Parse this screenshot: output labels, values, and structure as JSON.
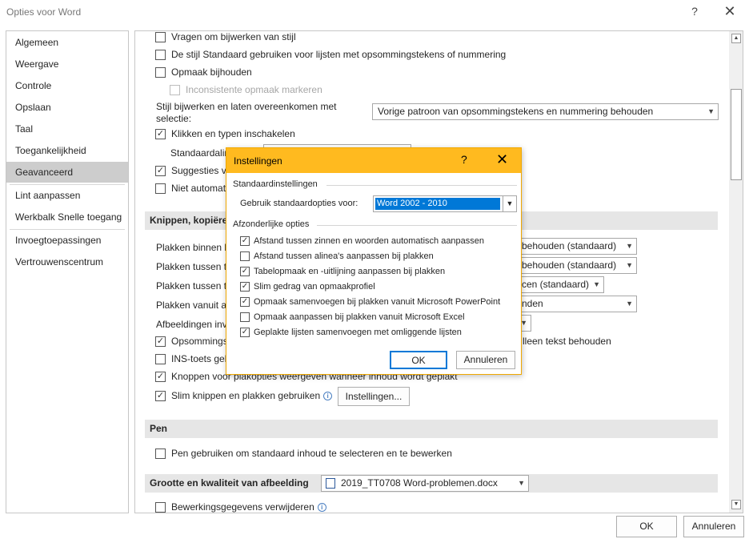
{
  "window": {
    "title": "Opties voor Word",
    "help": "?",
    "close": "✕"
  },
  "sidebar": {
    "items": [
      "Algemeen",
      "Weergave",
      "Controle",
      "Opslaan",
      "Taal",
      "Toegankelijkheid",
      "Geavanceerd",
      "Lint aanpassen",
      "Werkbalk Snelle toegang",
      "Invoegtoepassingen",
      "Vertrouwenscentrum"
    ],
    "selected": "Geavanceerd"
  },
  "content": {
    "rows": [
      "Vragen om bijwerken van stijl",
      "De stijl Standaard gebruiken voor lijsten met opsommingstekens of nummering",
      "Opmaak bijhouden",
      "Inconsistente opmaak markeren",
      "Klikken en typen inschakelen",
      "Suggesties va",
      "Niet automat",
      "Opsommings",
      "INS-toets geb",
      "Knoppen voor plakopties weergeven wanneer inhoud wordt geplakt",
      "Slim knippen en plakken gebruiken",
      "Pen gebruiken om standaard inhoud te selecteren en te bewerken",
      "Bewerkingsgegevens verwijderen"
    ],
    "style_label": "Stijl bijwerken en laten overeenkomen met selectie:",
    "style_value": "Vorige patroon van opsommingstekens en nummering behouden",
    "standaard_label": "Standaardalin",
    "section_knippen": "Knippen, kopiëre",
    "paste": [
      {
        "label": "Plakken binnen h",
        "value": "behouden (standaard)"
      },
      {
        "label": "Plakken tussen tv",
        "value": "behouden (standaard)"
      },
      {
        "label": "Plakken tussen tv",
        "value": "cen (standaard)"
      },
      {
        "label": "Plakken vanuit ar",
        "value": "nden"
      }
    ],
    "images_label": "Afbeeldingen inv",
    "alleen_tekst": "lleen tekst behouden",
    "settings_button": "Instellingen...",
    "section_pen": "Pen",
    "section_grootte": "Grootte en kwaliteit van afbeelding",
    "document_value": "2019_TT0708 Word-problemen.docx",
    "info_icon": "i"
  },
  "footer": {
    "ok": "OK",
    "cancel": "Annuleren"
  },
  "dialog": {
    "title": "Instellingen",
    "help": "?",
    "close": "✕",
    "group_defaults": "Standaardinstellingen",
    "use_defaults_label": "Gebruik standaardopties voor:",
    "use_defaults_value": "Word 2002 - 2010",
    "group_individual": "Afzonderlijke opties",
    "options": [
      "Afstand tussen zinnen en woorden automatisch aanpassen",
      "Afstand tussen alinea's aanpassen bij plakken",
      "Tabelopmaak en -uitlijning aanpassen bij plakken",
      "Slim gedrag van opmaakprofiel",
      "Opmaak samenvoegen bij plakken vanuit Microsoft PowerPoint",
      "Opmaak aanpassen bij plakken vanuit Microsoft Excel",
      "Geplakte lijsten samenvoegen met omliggende lijsten"
    ],
    "checked_states": [
      true,
      false,
      true,
      true,
      true,
      false,
      true
    ],
    "ok": "OK",
    "cancel": "Annuleren"
  },
  "icons": {
    "check": "✓",
    "dropdown": "▼",
    "scroll_up": "▲",
    "scroll_down": "▼"
  },
  "colors": {
    "dialog_title": "#ffba1f",
    "selection": "#0078d7",
    "sidebar_selected": "#cdcdcd"
  }
}
